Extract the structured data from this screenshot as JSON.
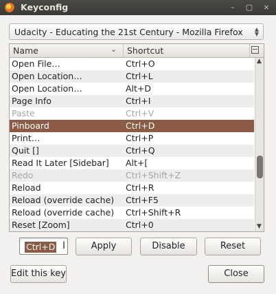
{
  "window": {
    "title": "Keyconfig",
    "controls": {
      "minimize": "–",
      "maximize": "▢",
      "close": "×"
    }
  },
  "profile": {
    "selected": "Udacity - Educating the 21st Century - Mozilla Firefox",
    "arrow_up": "▲",
    "arrow_down": "▼"
  },
  "table": {
    "columns": {
      "name": "Name",
      "shortcut": "Shortcut"
    },
    "sort_indicator": "⌄",
    "rows": [
      {
        "name": "Open File…",
        "shortcut": "Ctrl+O",
        "state": "normal"
      },
      {
        "name": "Open Location…",
        "shortcut": "Ctrl+L",
        "state": "normal"
      },
      {
        "name": "Open Location…",
        "shortcut": "Alt+D",
        "state": "normal"
      },
      {
        "name": "Page Info",
        "shortcut": "Ctrl+I",
        "state": "normal"
      },
      {
        "name": "Paste",
        "shortcut": "Ctrl+V",
        "state": "disabled"
      },
      {
        "name": "Pinboard",
        "shortcut": "Ctrl+D",
        "state": "selected"
      },
      {
        "name": "Print…",
        "shortcut": "Ctrl+P",
        "state": "normal"
      },
      {
        "name": "Quit []",
        "shortcut": "Ctrl+Q",
        "state": "normal"
      },
      {
        "name": "Read It Later [Sidebar]",
        "shortcut": "Alt+[",
        "state": "normal"
      },
      {
        "name": "Redo",
        "shortcut": "Ctrl+Shift+Z",
        "state": "disabled"
      },
      {
        "name": "Reload",
        "shortcut": "Ctrl+R",
        "state": "normal"
      },
      {
        "name": "Reload (override cache)",
        "shortcut": "Ctrl+F5",
        "state": "normal"
      },
      {
        "name": "Reload (override cache)",
        "shortcut": "Ctrl+Shift+R",
        "state": "normal"
      },
      {
        "name": "Reset [Zoom]",
        "shortcut": "Ctrl+0",
        "state": "normal"
      }
    ]
  },
  "scrollbar": {
    "up": "▲",
    "down": "▼"
  },
  "editor": {
    "key_value": "Ctrl+D",
    "cursor": "I",
    "apply_label": "Apply",
    "disable_label": "Disable",
    "reset_label": "Reset",
    "edit_label": "Edit this key",
    "close_label": "Close"
  },
  "colors": {
    "selection": "#8c5b46",
    "titlebar": "#3c3b37",
    "disabled_text": "#a9a6a1"
  }
}
